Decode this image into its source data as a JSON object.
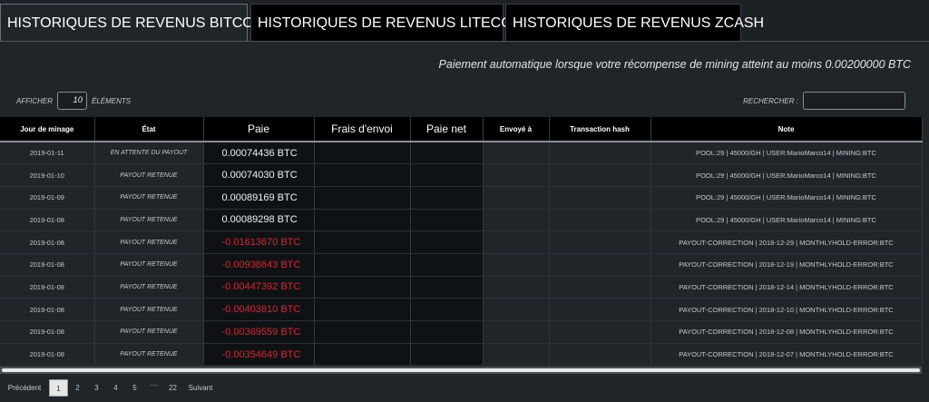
{
  "tabs": [
    {
      "label": "HISTORIQUES DE REVENUS BITCOIN"
    },
    {
      "label": "HISTORIQUES DE REVENUS LITECOIN"
    },
    {
      "label": "HISTORIQUES DE REVENUS ZCASH"
    }
  ],
  "notice": {
    "text": "Paiement automatique lorsque votre récompense de mining atteint au moins",
    "threshold": "0.00200000 BTC"
  },
  "controls": {
    "afficher": "AFFICHER",
    "length_value": "10",
    "elements": "ÉLÉMENTS",
    "rechercher": "RECHERCHER :"
  },
  "columns": [
    "Jour de minage",
    "État",
    "Paie",
    "Frais d'envoi",
    "Paie net",
    "Envoyé à",
    "Transaction hash",
    "Note"
  ],
  "rows": [
    {
      "date": "2019-01-11",
      "etat": "EN ATTENTE DU PAYOUT",
      "paie": "0.00074436 BTC",
      "negative": false,
      "note": "POOL:29 | 45000/GH | USER:MarioMarco14 | MINING:BTC"
    },
    {
      "date": "2019-01-10",
      "etat": "PAYOUT RETENUE",
      "paie": "0.00074030 BTC",
      "negative": false,
      "note": "POOL:29 | 45000/GH | USER:MarioMarco14 | MINING:BTC"
    },
    {
      "date": "2019-01-09",
      "etat": "PAYOUT RETENUE",
      "paie": "0.00089169 BTC",
      "negative": false,
      "note": "POOL:29 | 45000/GH | USER:MarioMarco14 | MINING:BTC"
    },
    {
      "date": "2019-01-08",
      "etat": "PAYOUT RETENUE",
      "paie": "0.00089298 BTC",
      "negative": false,
      "note": "POOL:29 | 45000/GH | USER:MarioMarco14 | MINING:BTC"
    },
    {
      "date": "2019-01-08",
      "etat": "PAYOUT RETENUE",
      "paie": "-0.01613670 BTC",
      "negative": true,
      "note": "PAYOUT-CORRECTION | 2018-12-29 | MONTHLYHOLD-ERROR:BTC"
    },
    {
      "date": "2019-01-08",
      "etat": "PAYOUT RETENUE",
      "paie": "-0.00938643 BTC",
      "negative": true,
      "note": "PAYOUT-CORRECTION | 2018-12-19 | MONTHLYHOLD-ERROR:BTC"
    },
    {
      "date": "2019-01-08",
      "etat": "PAYOUT RETENUE",
      "paie": "-0.00447392 BTC",
      "negative": true,
      "note": "PAYOUT-CORRECTION | 2018-12-14 | MONTHLYHOLD-ERROR:BTC"
    },
    {
      "date": "2019-01-08",
      "etat": "PAYOUT RETENUE",
      "paie": "-0.00403810 BTC",
      "negative": true,
      "note": "PAYOUT-CORRECTION | 2018-12-10 | MONTHLYHOLD-ERROR:BTC"
    },
    {
      "date": "2019-01-08",
      "etat": "PAYOUT RETENUE",
      "paie": "-0.00369559 BTC",
      "negative": true,
      "note": "PAYOUT-CORRECTION | 2018-12-08 | MONTHLYHOLD-ERROR:BTC"
    },
    {
      "date": "2019-01-08",
      "etat": "PAYOUT RETENUE",
      "paie": "-0.00354649 BTC",
      "negative": true,
      "note": "PAYOUT-CORRECTION | 2018-12-07 | MONTHLYHOLD-ERROR:BTC"
    }
  ],
  "pagination": {
    "previous": "Précédent",
    "pages": [
      "1",
      "2",
      "3",
      "4",
      "5",
      "…",
      "22"
    ],
    "current": "1",
    "next": "Suivant"
  },
  "colors": {
    "negative": "#d9262c",
    "header_bg": "#000000",
    "panel_bg": "#20252a"
  }
}
